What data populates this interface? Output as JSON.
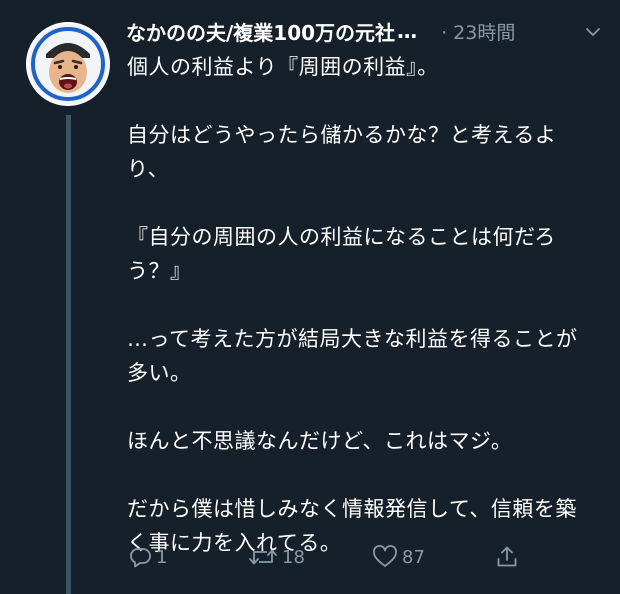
{
  "tweet": {
    "display_name": "なかのの夫/複業100万の元社",
    "ellipsis": "…",
    "time": "· 23時間",
    "paragraphs": [
      "個人の利益より『周囲の利益』。",
      "自分はどうやったら儲かるかな？と考えるより、",
      "『自分の周囲の人の利益になることは何だろう？』",
      "…って考えた方が結局大きな利益を得ることが多い。",
      "ほんと不思議なんだけど、これはマジ。",
      "だから僕は惜しみなく情報発信して、信頼を築く事に力を入れてる。"
    ]
  },
  "actions": {
    "reply_count": "1",
    "retweet_count": "18",
    "like_count": "87"
  },
  "colors": {
    "background": "#15202b",
    "muted": "#8899a6",
    "thread_line": "#3d5466",
    "avatar_ring": "#1d63c8"
  },
  "icons": [
    "chevron-down-icon",
    "reply-icon",
    "retweet-icon",
    "like-icon",
    "share-icon"
  ]
}
